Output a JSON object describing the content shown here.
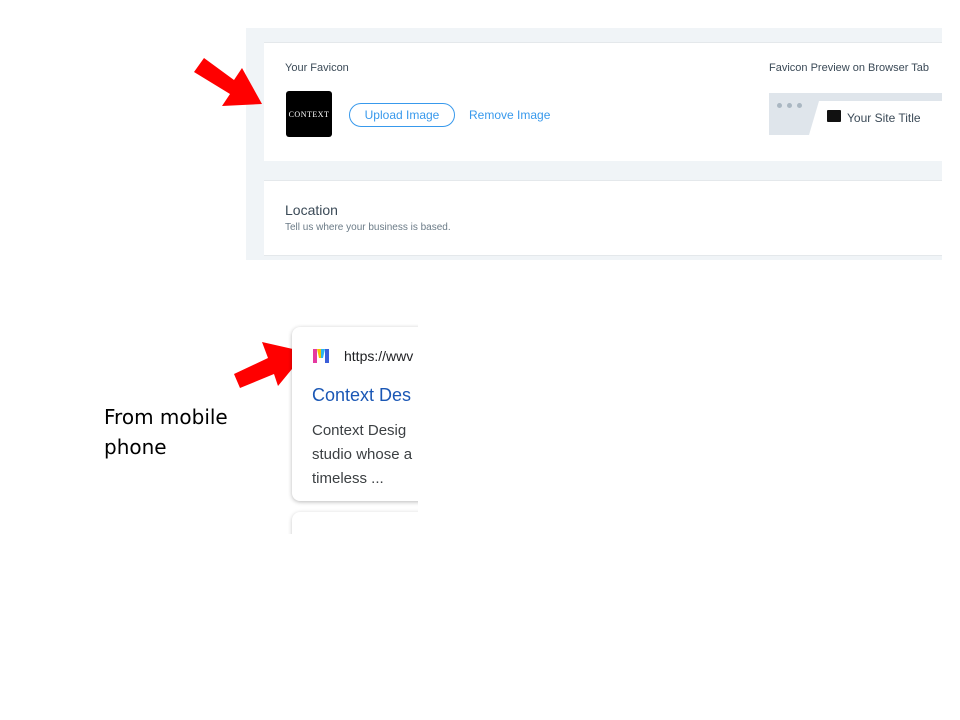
{
  "settings": {
    "favicon_label": "Your Favicon",
    "favicon_thumb_text": "CONTEXT",
    "upload_label": "Upload Image",
    "remove_label": "Remove Image",
    "preview_label": "Favicon Preview on Browser Tab",
    "tab_title": "Your Site Title",
    "location_title": "Location",
    "location_desc": "Tell us where your business is based."
  },
  "mobile_result": {
    "url": "https://wwv",
    "title": "Context Des",
    "snippet_lines": [
      "Context Desig",
      "studio whose a",
      "timeless ..."
    ]
  },
  "caption_lines": [
    "From mobile",
    "phone"
  ],
  "colors": {
    "arrow": "#ff0000",
    "link_blue": "#3899ec",
    "result_title": "#1a57b5"
  },
  "icons": {
    "arrow_1": "red-arrow-icon",
    "arrow_2": "red-arrow-icon",
    "mobile_favicon": "multicolor-m-logo-icon"
  }
}
